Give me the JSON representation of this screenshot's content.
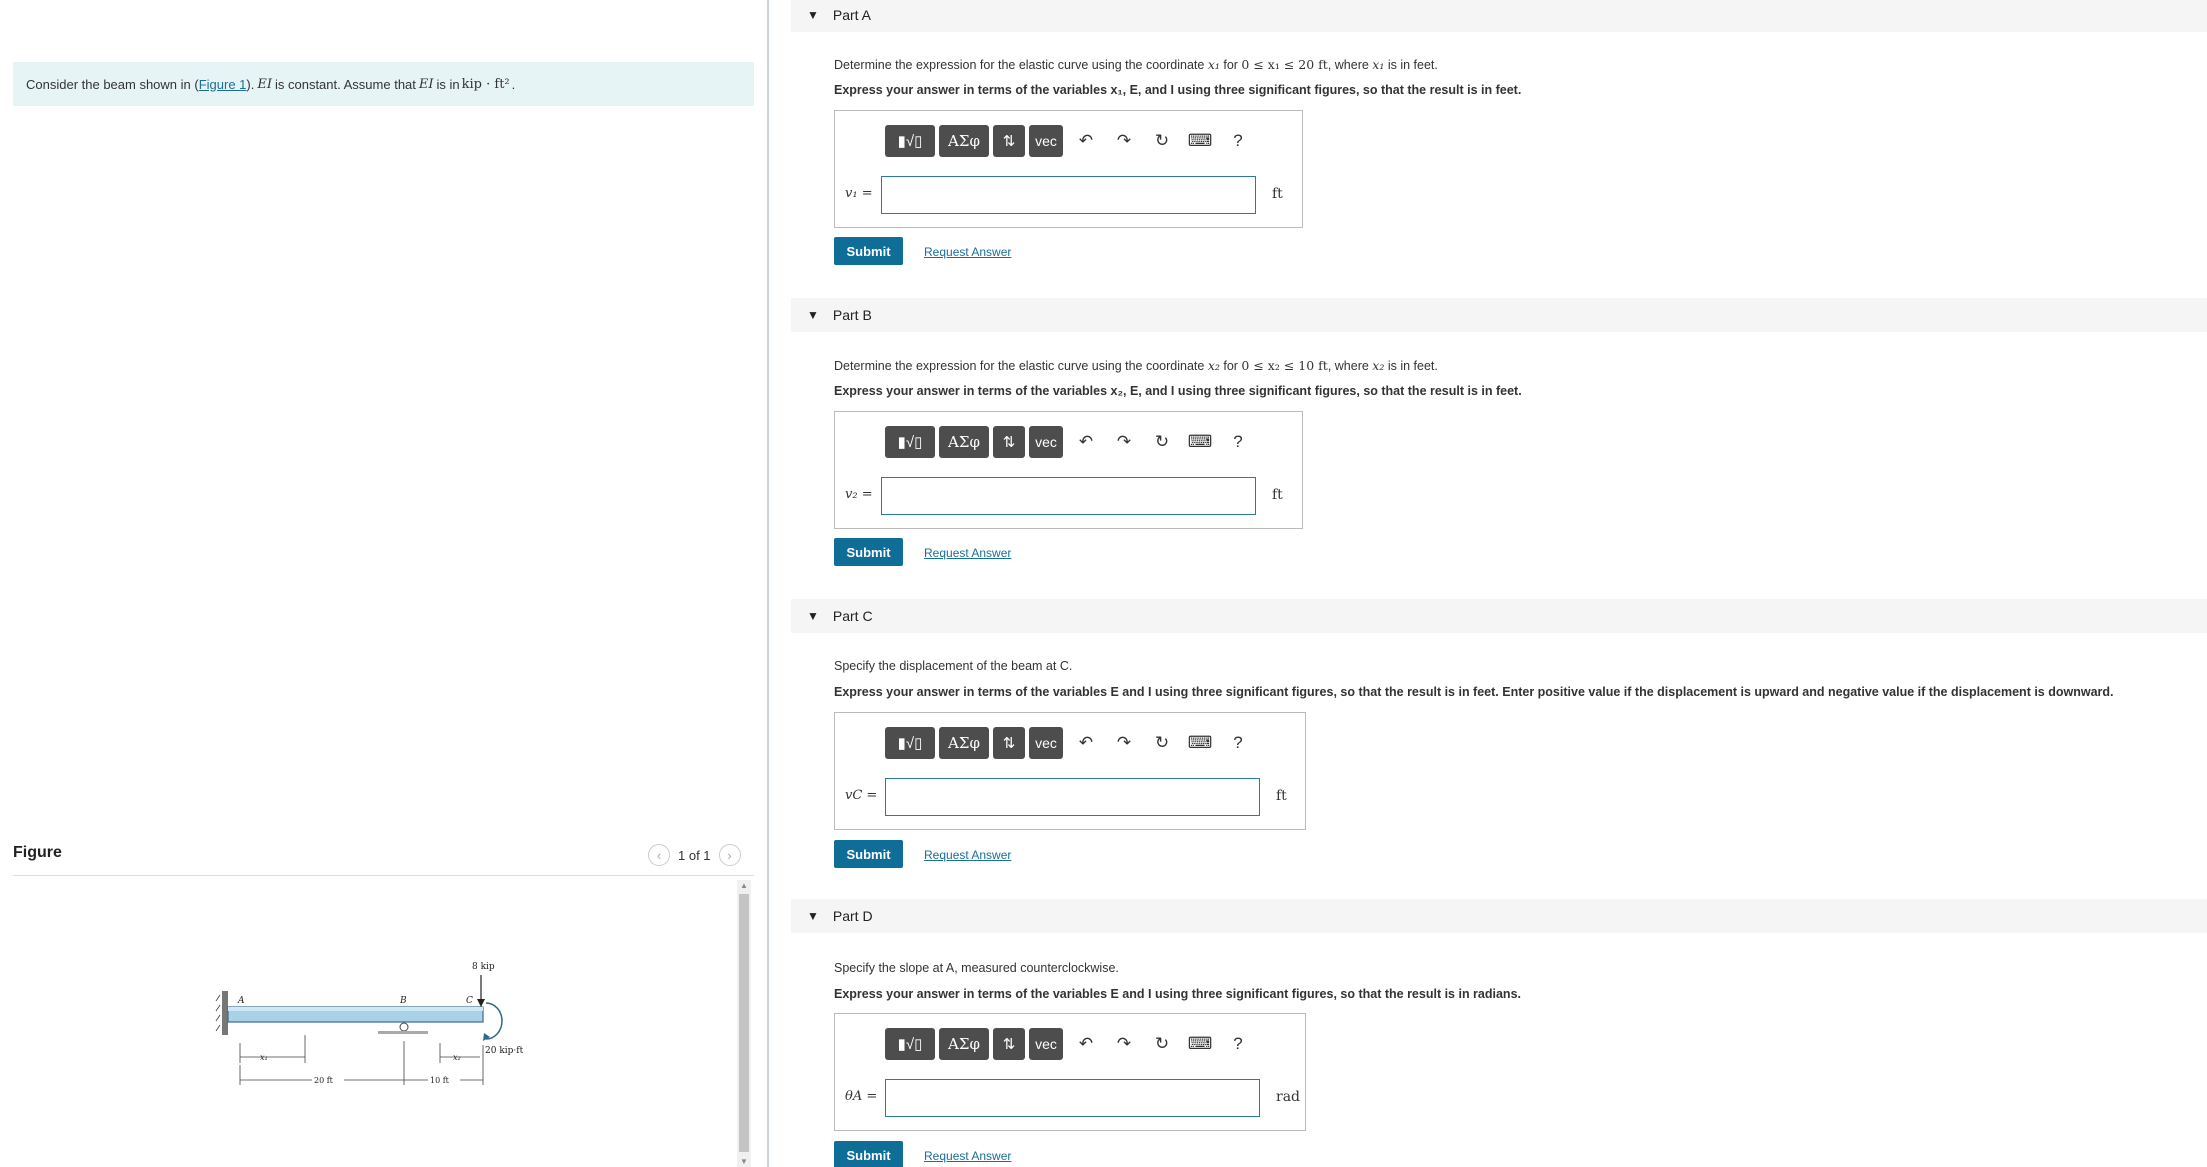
{
  "intro": {
    "pre": "Consider the beam shown in (",
    "link": "Figure 1",
    "mid1": "). ",
    "ei1": "EI",
    "mid2": " is constant. Assume that ",
    "ei2": "EI",
    "mid3": " is in ",
    "units": "kip · ft²",
    "end": "."
  },
  "figure": {
    "title": "Figure",
    "pager": "1 of 1",
    "labels": {
      "A": "A",
      "B": "B",
      "C": "C",
      "load": "8 kip",
      "moment": "20 kip·ft",
      "x1": "x₁",
      "x2": "x₂",
      "d1": "20 ft",
      "d2": "10 ft"
    }
  },
  "toolbar": {
    "vec": "vec",
    "greek": "ΑΣφ",
    "help": "?"
  },
  "actions": {
    "submit": "Submit",
    "request": "Request Answer"
  },
  "parts": [
    {
      "title": "Part A",
      "q_pre": "Determine the expression for the elastic curve using the coordinate ",
      "q_var": "x₁",
      "q_mid": " for ",
      "q_math": "0 ≤ x₁ ≤ 20 ft",
      "q_mid2": ", where ",
      "q_var2": "x₁",
      "q_end": " is in feet.",
      "instr": "Express your answer in terms of the variables x₁, E, and I using three significant figures, so that the result is in feet.",
      "label": "v₁ =",
      "unit": "ft"
    },
    {
      "title": "Part B",
      "q_pre": "Determine the expression for the elastic curve using the coordinate ",
      "q_var": "x₂",
      "q_mid": " for ",
      "q_math": "0 ≤ x₂ ≤ 10 ft",
      "q_mid2": ", where ",
      "q_var2": "x₂",
      "q_end": " is in feet.",
      "instr": "Express your answer in terms of the variables x₂, E, and I using three significant figures, so that the result is in feet.",
      "label": "v₂ =",
      "unit": "ft"
    },
    {
      "title": "Part C",
      "q_text": "Specify the displacement of the beam at C.",
      "instr": "Express your answer in terms of the variables E and I using three significant figures, so that the result is in feet. Enter positive value if the displacement is upward and negative value if the displacement is downward.",
      "label": "vC =",
      "unit": "ft"
    },
    {
      "title": "Part D",
      "q_text": "Specify the slope at A, measured counterclockwise.",
      "instr": "Express your answer in terms of the variables E and I using three significant figures, so that the result is in radians.",
      "label": "θA =",
      "unit": "rad"
    }
  ]
}
